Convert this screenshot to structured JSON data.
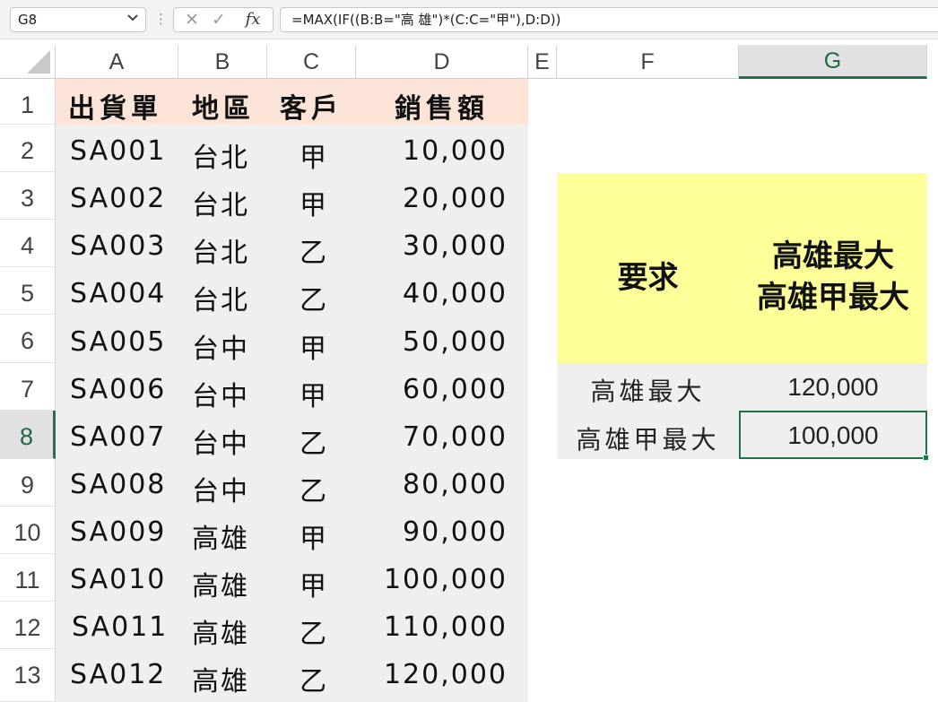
{
  "formula_bar": {
    "name_box": "G8",
    "formula": "=MAX(IF((B:B=\"高 雄\")*(C:C=\"甲\"),D:D))"
  },
  "columns": [
    "A",
    "B",
    "C",
    "D",
    "E",
    "F",
    "G"
  ],
  "selected_column": "G",
  "rows": [
    "1",
    "2",
    "3",
    "4",
    "5",
    "6",
    "7",
    "8",
    "9",
    "10",
    "11",
    "12",
    "13"
  ],
  "selected_row": "8",
  "table": {
    "headers": [
      "出貨單",
      "地區",
      "客戶",
      "銷售額"
    ],
    "data": [
      [
        "SA001",
        "台北",
        "甲",
        "10,000"
      ],
      [
        "SA002",
        "台北",
        "甲",
        "20,000"
      ],
      [
        "SA003",
        "台北",
        "乙",
        "30,000"
      ],
      [
        "SA004",
        "台北",
        "乙",
        "40,000"
      ],
      [
        "SA005",
        "台中",
        "甲",
        "50,000"
      ],
      [
        "SA006",
        "台中",
        "甲",
        "60,000"
      ],
      [
        "SA007",
        "台中",
        "乙",
        "70,000"
      ],
      [
        "SA008",
        "台中",
        "乙",
        "80,000"
      ],
      [
        "SA009",
        "高雄",
        "甲",
        "90,000"
      ],
      [
        "SA010",
        "高雄",
        "甲",
        "100,000"
      ],
      [
        "SA011",
        "高雄",
        "乙",
        "110,000"
      ],
      [
        "SA012",
        "高雄",
        "乙",
        "120,000"
      ]
    ]
  },
  "summary": {
    "requirement_label": "要求",
    "requirement_line1": "高雄最大",
    "requirement_line2": "高雄甲最大",
    "rows": [
      {
        "label": "高雄最大",
        "value": "120,000"
      },
      {
        "label": "高雄甲最大",
        "value": "100,000"
      }
    ]
  },
  "icons": {
    "cancel": "✕",
    "enter": "✓",
    "fx": "fx",
    "name_box_dropdown": "⌄",
    "dots": "⋮"
  },
  "colors": {
    "accent_green": "#217346",
    "header_band": "#fde4d8",
    "highlight_yellow": "#ffff99",
    "table_gray": "#efefef"
  }
}
